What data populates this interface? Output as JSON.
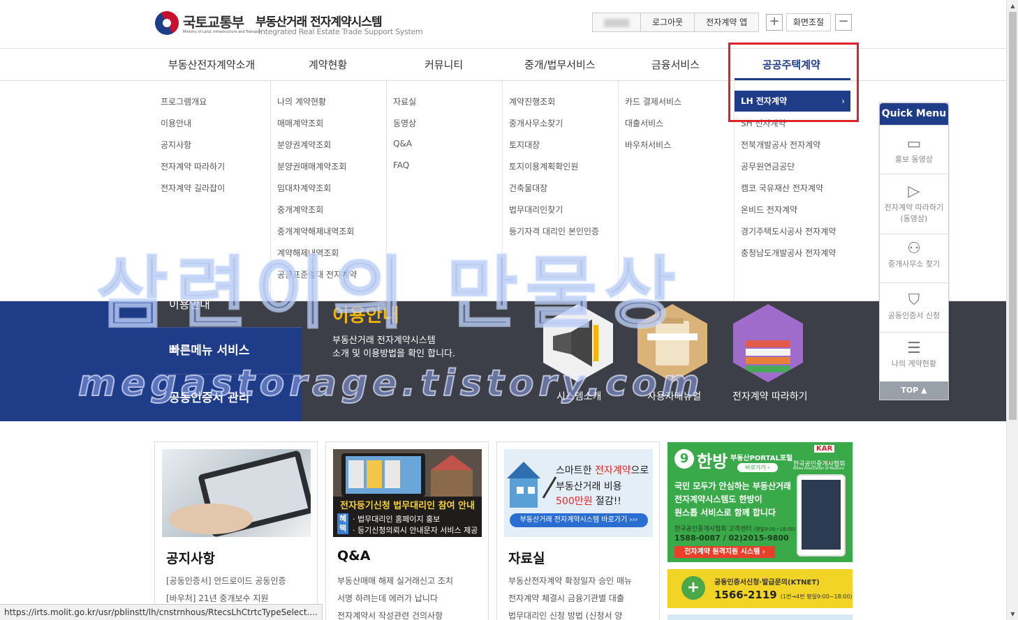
{
  "header": {
    "ministry": "국토교통부",
    "ministry_en": "Ministry of Land, Infrastructure and Transport",
    "system_title": "부동산거래 전자계약시스템",
    "system_en": "Integrated Real Estate Trade Support System",
    "logout": "로그아웃",
    "app": "전자계약 앱",
    "zoom_in": "+",
    "zoom_label": "화면조절",
    "zoom_out": "−"
  },
  "nav": {
    "items": [
      "부동산전자계약소개",
      "계약현황",
      "커뮤니티",
      "중개/법무서비스",
      "금융서비스",
      "공공주택계약"
    ],
    "active": "공공주택계약"
  },
  "dropdown": {
    "col1": [
      "프로그램개요",
      "이용안내",
      "공지사항",
      "전자계약 따라하기",
      "전자계약 길라잡이"
    ],
    "col2": [
      "나의 계약현황",
      "매매계약조회",
      "분양권계약조회",
      "분양권매매계약조회",
      "임대차계약조회",
      "중개계약조회",
      "중개계약해제내역조회",
      "계약해제내역조회",
      "공공표준임대 전자계약"
    ],
    "col3": [
      "자료실",
      "동영상",
      "Q&A",
      "FAQ"
    ],
    "col4": [
      "계약진행조회",
      "중개사무소찾기",
      "토지대장",
      "토지이용계획확인원",
      "건축물대장",
      "법무대리인찾기",
      "등기자격 대리인 본인인증"
    ],
    "col5": [
      "카드 결제서비스",
      "대출서비스",
      "바우처서비스"
    ],
    "col6_active": "LH 전자계약",
    "col6": [
      "SH 전자계약",
      "전북개발공사 전자계약",
      "공무원연금공단",
      "캠코 국유재산 전자계약",
      "온비드 전자계약",
      "경기주택도시공사 전자계약",
      "충청남도개발공사 전자계약"
    ]
  },
  "banner": {
    "tab_top": "이용안내",
    "tab_quick": "빠른메뉴 서비스",
    "tab_cert": "공동인증서 관리",
    "info_title": "이용안내",
    "info_desc1": "부동산거래 전자계약시스템",
    "info_desc2": "소개 및 이용방법을 확인 합니다.",
    "icons": [
      "시스템소개",
      "사용자매뉴얼",
      "전자계약 따라하기"
    ]
  },
  "quick_menu": {
    "title": "Quick Menu",
    "items": [
      {
        "label": "홍보 동영상",
        "icon": "video-icon"
      },
      {
        "label": "전자계약 따라하기 (동영상)",
        "icon": "play-icon"
      },
      {
        "label": "중개사무소 찾기",
        "icon": "user-add-icon"
      },
      {
        "label": "공동인증서 신청",
        "icon": "shield-icon"
      },
      {
        "label": "나의 계약현황",
        "icon": "document-icon"
      }
    ],
    "top": "TOP ▲"
  },
  "cards": [
    {
      "title": "공지사항",
      "lines": [
        "[공동인증서] 안드로이드 공동인증",
        "[바우처] 21년 중개보수 지원"
      ]
    },
    {
      "title": "Q&A",
      "lines": [
        "부동산매매 해제 실거래신고 조치",
        "서명 하려는데 에러가 납니다",
        "전자계약서 작성관련 건의사항"
      ],
      "banner_title": "전자등기신청 법무대리인 참여 안내",
      "banner_tag": "혜택",
      "banner_line1": "· 법무대리인 홈페이지 홍보",
      "banner_line2": "· 등기신청의뢰시 안내문자 서비스 제공"
    },
    {
      "title": "자료실",
      "lines": [
        "부동산전자계약 확정일자 승인 매뉴",
        "전자계약 체결시 금융기관별 대출",
        "법무대리인 신청 방법 (신청서 양"
      ],
      "promo1": "스마트한",
      "promo1b": "전자계약",
      "promo1c": "으로",
      "promo2": "부동산거래 비용",
      "promo3a": "500만원",
      "promo3b": " 절감!!",
      "promo_btn": "부동산거래 전자계약시스템 바로가기 ›››"
    }
  ],
  "ads": {
    "hanbang_logo": "한방",
    "hanbang_portal": "부동산PORTAL포털",
    "hanbang_go": "바로가기 ›",
    "kar": "한국공인중개사협회",
    "kar_en": "Korea Association of Realtors",
    "hanbang_l1": "국민 모두가 안심하는 부동산거래",
    "hanbang_l2": "전자계약시스템도 한방이",
    "hanbang_l3": "원스톱 서비스로 함께 합니다",
    "hanbang_center": "한국공인중개사협회 고객센터",
    "hanbang_hours": "(평일9:00~18:00)",
    "hanbang_phone": "1588-0087 / 02)2015-9800",
    "hanbang_btn": "전자계약 원격지원 시스템 ›",
    "ktnet_title": "공동인증서신청·발급문의(KTNET)",
    "ktnet_phone": "1566-2119",
    "ktnet_sub": "(1번→4번 평일9:00~18:00)"
  },
  "watermark": {
    "line1": "삼련이의 만물상",
    "line2": "megastorage.tistory.com"
  },
  "status_url": "https://irts.molit.go.kr/usr/pblinstt/lh/cnstrnhous/RtecsLhCtrtcTypeSelect...."
}
